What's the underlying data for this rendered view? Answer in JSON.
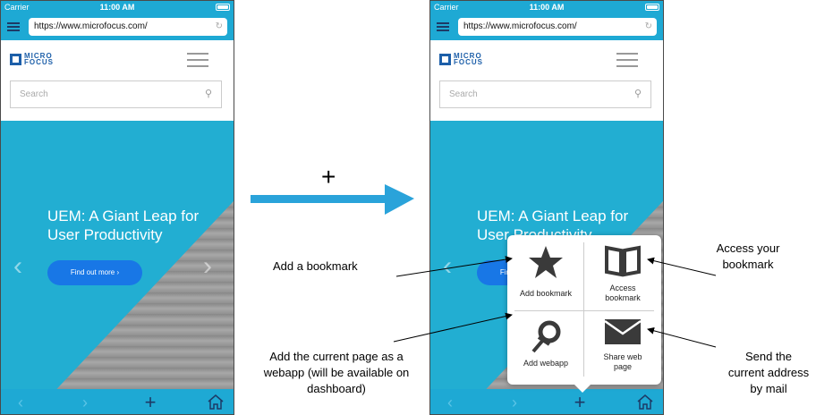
{
  "status": {
    "carrier": "Carrier",
    "time": "11:00 AM"
  },
  "browser": {
    "url": "https://www.microfocus.com/"
  },
  "site": {
    "logo_line1": "MICRO",
    "logo_line2": "FOCUS",
    "search_placeholder": "Search",
    "hero_title": "UEM: A Giant Leap for User Productivity",
    "hero_button": "Find out more ›"
  },
  "toolbar": {
    "back": "‹",
    "forward": "›",
    "add": "+"
  },
  "transition": {
    "plus": "+"
  },
  "popup": {
    "add_bookmark": "Add bookmark",
    "access_bookmark": "Access bookmark",
    "add_webapp": "Add webapp",
    "share_web_page": "Share web page"
  },
  "annotations": {
    "add_bookmark": "Add a bookmark",
    "access_bookmark": "Access your bookmark",
    "add_webapp": "Add the current page as a webapp (will be available on dashboard)",
    "send_mail": "Send the current address by mail"
  },
  "colors": {
    "accent": "#1ea9d4",
    "dark": "#1d3a66",
    "button": "#1877e6",
    "brand": "#1d5fa9"
  }
}
